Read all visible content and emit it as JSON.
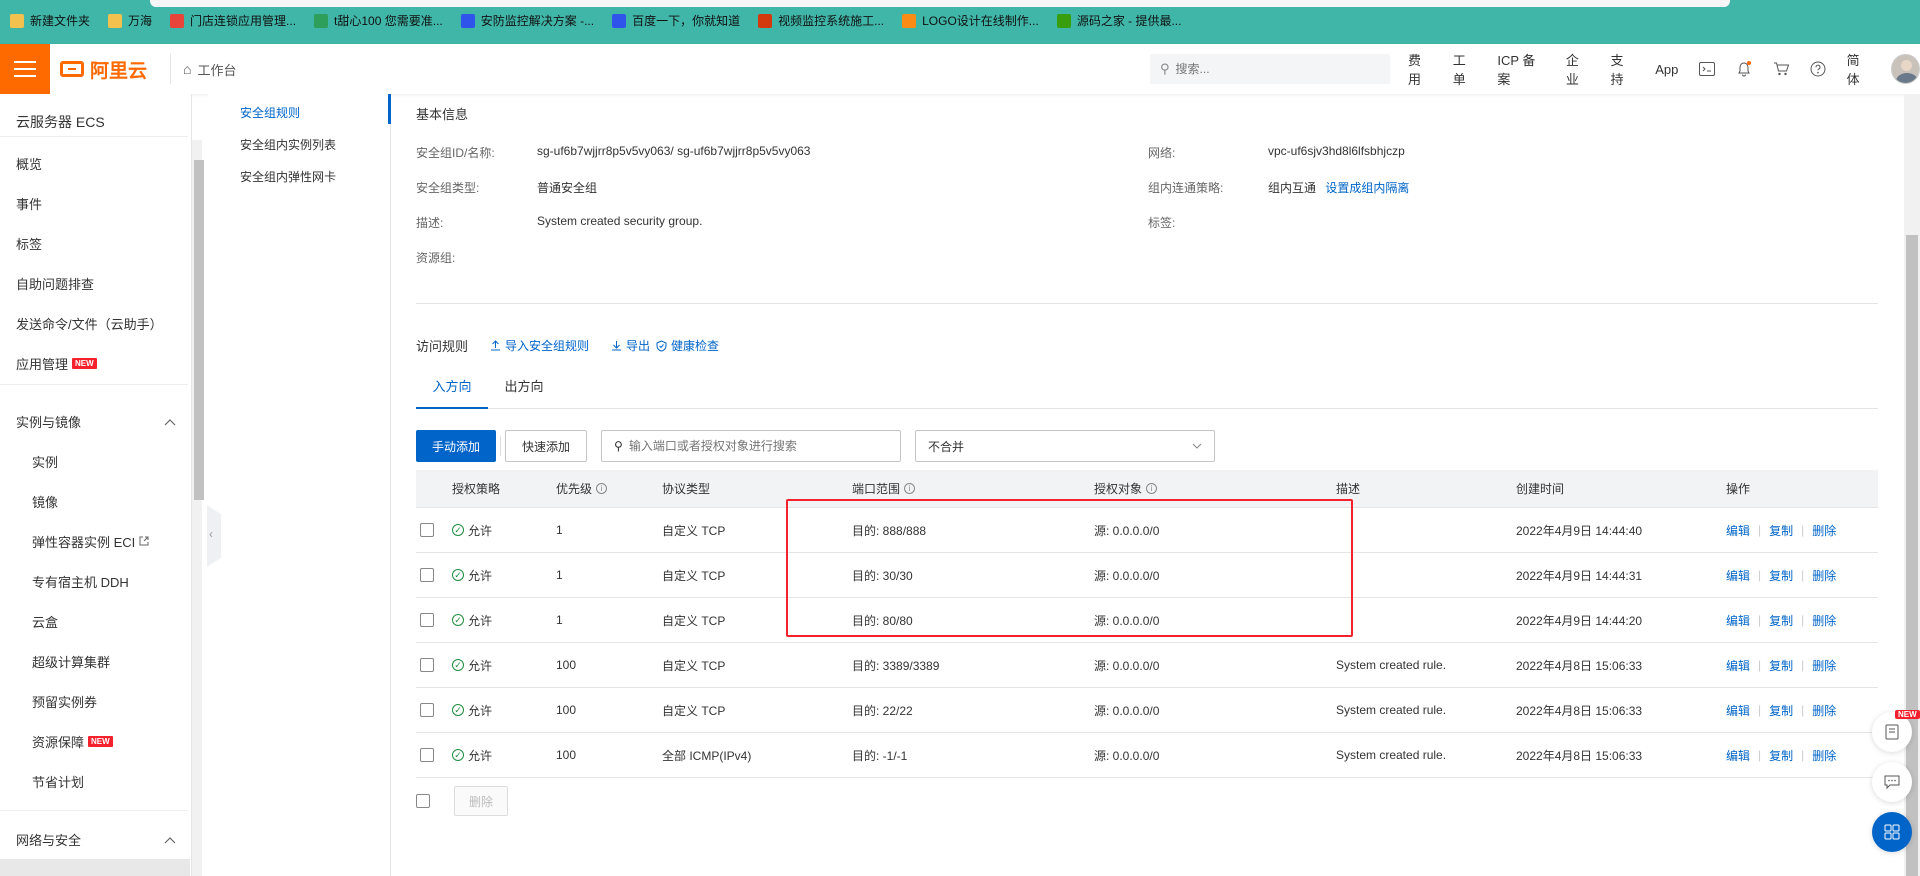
{
  "bookmarks": [
    {
      "label": "新建文件夹",
      "icon": "folder-icon",
      "color": "#f2c14e"
    },
    {
      "label": "万海",
      "icon": "folder-icon",
      "color": "#f2c14e"
    },
    {
      "label": "门店连锁应用管理...",
      "icon": "app-grid-icon",
      "color": "#e8443a"
    },
    {
      "label": "t甜心100 您需要准...",
      "icon": "leaf-icon",
      "color": "#2e9e5b"
    },
    {
      "label": "安防监控解决方案 -...",
      "icon": "paw-icon",
      "color": "#2f54eb"
    },
    {
      "label": "百度一下，你就知道",
      "icon": "paw-icon",
      "color": "#2f54eb"
    },
    {
      "label": "视频监控系统施工...",
      "icon": "s-logo-icon",
      "color": "#d4380d"
    },
    {
      "label": "LOGO设计在线制作...",
      "icon": "swirl-icon",
      "color": "#fa8c16"
    },
    {
      "label": "源码之家 - 提供最...",
      "icon": "m-logo-icon",
      "color": "#389e0d"
    }
  ],
  "header": {
    "logo_text": "阿里云",
    "workbench": "工作台",
    "search_placeholder": "搜索...",
    "nav": [
      "费用",
      "工单",
      "ICP 备案",
      "企业",
      "支持",
      "App"
    ],
    "lang": "简体",
    "brand_color": "#ff6a00"
  },
  "sidebar": {
    "title": "云服务器 ECS",
    "items": [
      {
        "label": "概览",
        "new": false
      },
      {
        "label": "事件",
        "new": false
      },
      {
        "label": "标签",
        "new": false
      },
      {
        "label": "自助问题排查",
        "new": false
      },
      {
        "label": "发送命令/文件（云助手）",
        "new": false
      },
      {
        "label": "应用管理",
        "new": true
      }
    ],
    "group1": {
      "label": "实例与镜像",
      "items": [
        {
          "label": "实例",
          "new": false
        },
        {
          "label": "镜像",
          "new": false
        },
        {
          "label": "弹性容器实例 ECI",
          "new": false,
          "external": true
        },
        {
          "label": "专有宿主机 DDH",
          "new": false
        },
        {
          "label": "云盒",
          "new": false
        },
        {
          "label": "超级计算集群",
          "new": false
        },
        {
          "label": "预留实例券",
          "new": false
        },
        {
          "label": "资源保障",
          "new": true
        },
        {
          "label": "节省计划",
          "new": false
        }
      ]
    },
    "group2": {
      "label": "网络与安全"
    },
    "new_badge": "NEW"
  },
  "subnav": {
    "items": [
      "安全组规则",
      "安全组内实例列表",
      "安全组内弹性网卡"
    ]
  },
  "basic_info": {
    "title": "基本信息",
    "left": [
      {
        "label": "安全组ID/名称:",
        "value": "sg-uf6b7wjjrr8p5v5vy063/ sg-uf6b7wjjrr8p5v5vy063"
      },
      {
        "label": "安全组类型:",
        "value": "普通安全组"
      },
      {
        "label": "描述:",
        "value": "System created security group."
      },
      {
        "label": "资源组:",
        "value": ""
      }
    ],
    "right": [
      {
        "label": "网络:",
        "value": "vpc-uf6sjv3hd8l6lfsbhjczp"
      },
      {
        "label": "组内连通策略:",
        "value": "组内互通",
        "link": "设置成组内隔离"
      },
      {
        "label": "标签:",
        "value": ""
      }
    ]
  },
  "rules": {
    "title": "访问规则",
    "actions": [
      "导入安全组规则",
      "导出",
      "健康检查"
    ],
    "tabs": [
      "入方向",
      "出方向"
    ],
    "active_tab": 0,
    "toolbar": {
      "add": "手动添加",
      "quick_add": "快速添加",
      "search_placeholder": "输入端口或者授权对象进行搜索",
      "merge": "不合并"
    },
    "columns": [
      "授权策略",
      "优先级",
      "协议类型",
      "端口范围",
      "授权对象",
      "描述",
      "创建时间",
      "操作"
    ],
    "rows": [
      {
        "policy": "允许",
        "priority": "1",
        "protocol": "自定义 TCP",
        "port": "目的: 888/888",
        "source": "源: 0.0.0.0/0",
        "desc": "",
        "created": "2022年4月9日 14:44:40"
      },
      {
        "policy": "允许",
        "priority": "1",
        "protocol": "自定义 TCP",
        "port": "目的: 30/30",
        "source": "源: 0.0.0.0/0",
        "desc": "",
        "created": "2022年4月9日 14:44:31"
      },
      {
        "policy": "允许",
        "priority": "1",
        "protocol": "自定义 TCP",
        "port": "目的: 80/80",
        "source": "源: 0.0.0.0/0",
        "desc": "",
        "created": "2022年4月9日 14:44:20"
      },
      {
        "policy": "允许",
        "priority": "100",
        "protocol": "自定义 TCP",
        "port": "目的: 3389/3389",
        "source": "源: 0.0.0.0/0",
        "desc": "System created rule.",
        "created": "2022年4月8日 15:06:33"
      },
      {
        "policy": "允许",
        "priority": "100",
        "protocol": "自定义 TCP",
        "port": "目的: 22/22",
        "source": "源: 0.0.0.0/0",
        "desc": "System created rule.",
        "created": "2022年4月8日 15:06:33"
      },
      {
        "policy": "允许",
        "priority": "100",
        "protocol": "全部 ICMP(IPv4)",
        "port": "目的: -1/-1",
        "source": "源: 0.0.0.0/0",
        "desc": "System created rule.",
        "created": "2022年4月8日 15:06:33"
      }
    ],
    "ops": [
      "编辑",
      "复制",
      "删除"
    ],
    "delete_btn": "删除"
  },
  "colors": {
    "primary": "#0064c8",
    "highlight": "#f5222d",
    "allow": "#1e8e3e",
    "bookmark_bar": "#3fb6a8"
  },
  "floating": {
    "new_badge": "NEW"
  }
}
